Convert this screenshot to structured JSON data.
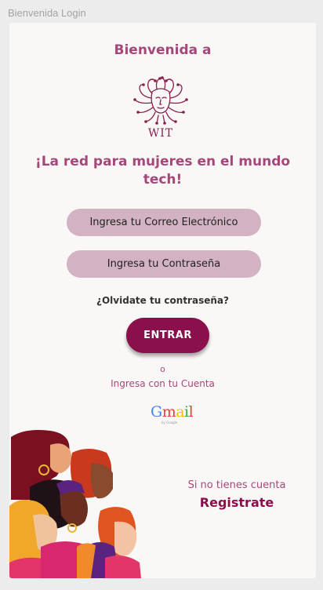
{
  "frame": {
    "title": "Bienvenida Login"
  },
  "header": {
    "welcome": "Bienvenida a"
  },
  "logo": {
    "text": "WIT"
  },
  "tagline": "¡La red para mujeres en el mundo tech!",
  "form": {
    "email_placeholder": "Ingresa tu Correo Electrónico",
    "password_placeholder": "Ingresa tu Contraseña",
    "forgot_password": "¿Olvidate tu contraseña?",
    "submit_label": "ENTRAR"
  },
  "alternative": {
    "or_text": "o",
    "account_text": "Ingresa con tu Cuenta",
    "gmail_letters": [
      "G",
      "m",
      "a",
      "i",
      "l"
    ],
    "gmail_colors": [
      "#4285F4",
      "#EA4335",
      "#FBBC05",
      "#34A853",
      "#EA4335"
    ],
    "gmail_subtext": "by Google"
  },
  "signup": {
    "prompt": "Si no tienes cuenta",
    "link_label": "Registrate"
  },
  "colors": {
    "accent": "#a4487a",
    "button": "#8a0f4a",
    "field_bg": "#d3b3c3"
  },
  "illustration": {
    "name": "women-group-illustration"
  }
}
